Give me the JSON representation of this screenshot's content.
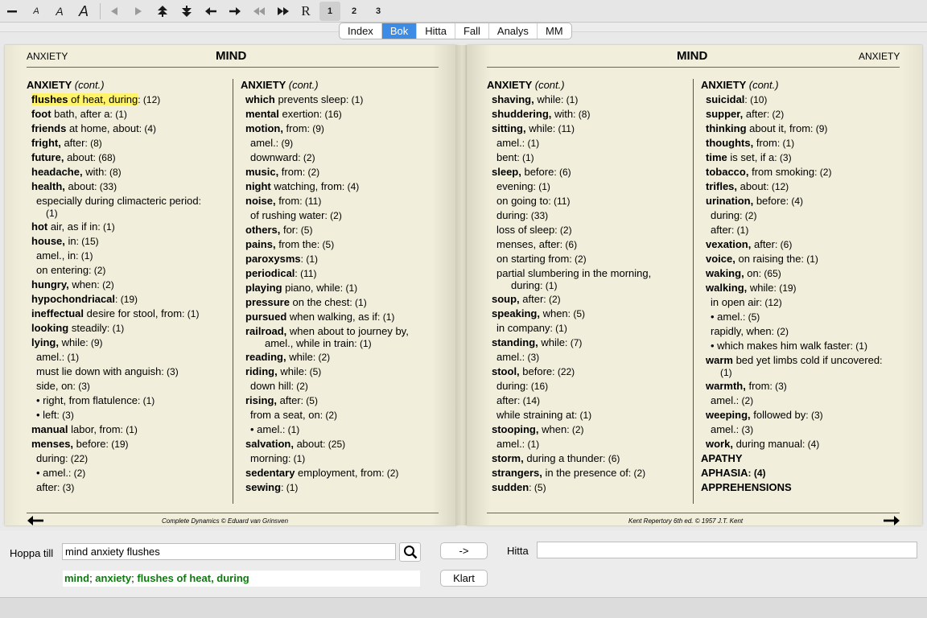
{
  "toolbar": {
    "font_size_labels": [
      "A",
      "A",
      "A"
    ],
    "reset_label": "R",
    "pages": [
      "1",
      "2",
      "3"
    ]
  },
  "tabs": [
    "Index",
    "Bok",
    "Hitta",
    "Fall",
    "Analys",
    "MM"
  ],
  "active_tab": "Bok",
  "left_page": {
    "header_word": "ANXIETY",
    "header_title": "MIND",
    "footer": "Complete Dynamics © Eduard van Grinsven",
    "col1": {
      "head": "ANXIETY",
      "head_cont": "(cont.)",
      "lines": [
        {
          "lvl": 1,
          "b": "flushes",
          "t": " of heat, during",
          "n": ": (12)",
          "hl": true
        },
        {
          "lvl": 1,
          "b": "foot",
          "t": " bath, after a",
          "n": ": (1)"
        },
        {
          "lvl": 1,
          "b": "friends",
          "t": " at home, about",
          "n": ": (4)"
        },
        {
          "lvl": 1,
          "b": "fright,",
          "t": " after",
          "n": ": (8)"
        },
        {
          "lvl": 1,
          "b": "future,",
          "t": " about",
          "n": ": (68)"
        },
        {
          "lvl": 1,
          "b": "headache,",
          "t": " with",
          "n": ": (8)"
        },
        {
          "lvl": 1,
          "b": "health,",
          "t": " about",
          "n": ": (33)"
        },
        {
          "lvl": 2,
          "b": "",
          "t": "especially during climacteric period",
          "n": ":"
        },
        {
          "lvl": 4,
          "b": "",
          "t": "",
          "n": "(1)",
          "cont": true
        },
        {
          "lvl": 1,
          "b": "hot",
          "t": " air, as if in",
          "n": ": (1)"
        },
        {
          "lvl": 1,
          "b": "house,",
          "t": " in",
          "n": ": (15)"
        },
        {
          "lvl": 2,
          "b": "",
          "t": "amel., in",
          "n": ": (1)"
        },
        {
          "lvl": 2,
          "b": "",
          "t": "on entering",
          "n": ": (2)"
        },
        {
          "lvl": 1,
          "b": "hungry,",
          "t": " when",
          "n": ": (2)"
        },
        {
          "lvl": 1,
          "b": "hypochondriacal",
          "t": "",
          "n": ": (19)"
        },
        {
          "lvl": 1,
          "b": "ineffectual",
          "t": " desire for stool, from",
          "n": ": (1)"
        },
        {
          "lvl": 1,
          "b": "looking",
          "t": " steadily",
          "n": ": (1)"
        },
        {
          "lvl": 1,
          "b": "lying,",
          "t": " while",
          "n": ": (9)"
        },
        {
          "lvl": 2,
          "b": "",
          "t": "amel.",
          "n": ": (1)"
        },
        {
          "lvl": 2,
          "b": "",
          "t": "must lie down with anguish",
          "n": ": (3)"
        },
        {
          "lvl": 2,
          "b": "",
          "t": "side, on",
          "n": ": (3)"
        },
        {
          "lvl": 2,
          "b": "",
          "t": "• right, from flatulence",
          "n": ": (1)"
        },
        {
          "lvl": 2,
          "b": "",
          "t": "• left",
          "n": ": (3)"
        },
        {
          "lvl": 1,
          "b": "manual",
          "t": " labor, from",
          "n": ": (1)"
        },
        {
          "lvl": 1,
          "b": "menses,",
          "t": " before",
          "n": ": (19)"
        },
        {
          "lvl": 2,
          "b": "",
          "t": "during",
          "n": ": (22)"
        },
        {
          "lvl": 2,
          "b": "",
          "t": "• amel.",
          "n": ": (2)"
        },
        {
          "lvl": 2,
          "b": "",
          "t": "after",
          "n": ": (3)"
        }
      ]
    },
    "col2": {
      "head": "ANXIETY",
      "head_cont": "(cont.)",
      "lines": [
        {
          "lvl": 1,
          "b": "which",
          "t": " prevents sleep",
          "n": ": (1)"
        },
        {
          "lvl": 1,
          "b": "mental",
          "t": " exertion",
          "n": ": (16)"
        },
        {
          "lvl": 1,
          "b": "motion,",
          "t": " from",
          "n": ": (9)"
        },
        {
          "lvl": 2,
          "b": "",
          "t": "amel.",
          "n": ": (9)"
        },
        {
          "lvl": 2,
          "b": "",
          "t": "downward",
          "n": ": (2)"
        },
        {
          "lvl": 1,
          "b": "music,",
          "t": " from",
          "n": ": (2)"
        },
        {
          "lvl": 1,
          "b": "night",
          "t": " watching, from",
          "n": ": (4)"
        },
        {
          "lvl": 1,
          "b": "noise,",
          "t": " from",
          "n": ": (11)"
        },
        {
          "lvl": 2,
          "b": "",
          "t": "of rushing water",
          "n": ": (2)"
        },
        {
          "lvl": 1,
          "b": "others,",
          "t": " for",
          "n": ": (5)"
        },
        {
          "lvl": 1,
          "b": "pains,",
          "t": " from the",
          "n": ": (5)"
        },
        {
          "lvl": 1,
          "b": "paroxysms",
          "t": "",
          "n": ": (1)"
        },
        {
          "lvl": 1,
          "b": "periodical",
          "t": "",
          "n": ": (11)"
        },
        {
          "lvl": 1,
          "b": "playing",
          "t": " piano, while",
          "n": ": (1)"
        },
        {
          "lvl": 1,
          "b": "pressure",
          "t": " on the chest",
          "n": ": (1)"
        },
        {
          "lvl": 1,
          "b": "pursued",
          "t": " when walking, as if",
          "n": ": (1)"
        },
        {
          "lvl": 1,
          "b": "railroad,",
          "t": " when about to journey by,",
          "n": ""
        },
        {
          "lvl": 3,
          "b": "",
          "t": "amel., while in train",
          "n": ": (1)",
          "cont": true
        },
        {
          "lvl": 1,
          "b": "reading,",
          "t": " while",
          "n": ": (2)"
        },
        {
          "lvl": 1,
          "b": "riding,",
          "t": " while",
          "n": ": (5)"
        },
        {
          "lvl": 2,
          "b": "",
          "t": "down hill",
          "n": ": (2)"
        },
        {
          "lvl": 1,
          "b": "rising,",
          "t": " after",
          "n": ": (5)"
        },
        {
          "lvl": 2,
          "b": "",
          "t": "from a seat, on",
          "n": ": (2)"
        },
        {
          "lvl": 2,
          "b": "",
          "t": "• amel.",
          "n": ": (1)"
        },
        {
          "lvl": 1,
          "b": "salvation,",
          "t": " about",
          "n": ": (25)"
        },
        {
          "lvl": 2,
          "b": "",
          "t": "morning",
          "n": ": (1)"
        },
        {
          "lvl": 1,
          "b": "sedentary",
          "t": " employment, from",
          "n": ": (2)"
        },
        {
          "lvl": 1,
          "b": "sewing",
          "t": "",
          "n": ": (1)"
        }
      ]
    }
  },
  "right_page": {
    "header_word": "ANXIETY",
    "header_title": "MIND",
    "footer": "Kent Repertory 6th ed. © 1957 J.T. Kent",
    "col1": {
      "head": "ANXIETY",
      "head_cont": "(cont.)",
      "lines": [
        {
          "lvl": 1,
          "b": "shaving,",
          "t": " while",
          "n": ": (1)"
        },
        {
          "lvl": 1,
          "b": "shuddering,",
          "t": " with",
          "n": ": (8)"
        },
        {
          "lvl": 1,
          "b": "sitting,",
          "t": " while",
          "n": ": (11)"
        },
        {
          "lvl": 2,
          "b": "",
          "t": "amel.",
          "n": ": (1)"
        },
        {
          "lvl": 2,
          "b": "",
          "t": "bent",
          "n": ": (1)"
        },
        {
          "lvl": 1,
          "b": "sleep,",
          "t": " before",
          "n": ": (6)"
        },
        {
          "lvl": 2,
          "b": "",
          "t": "evening",
          "n": ": (1)"
        },
        {
          "lvl": 2,
          "b": "",
          "t": "on going to",
          "n": ": (11)"
        },
        {
          "lvl": 2,
          "b": "",
          "t": "during",
          "n": ": (33)"
        },
        {
          "lvl": 2,
          "b": "",
          "t": "loss of sleep",
          "n": ": (2)"
        },
        {
          "lvl": 2,
          "b": "",
          "t": "menses, after",
          "n": ": (6)"
        },
        {
          "lvl": 2,
          "b": "",
          "t": "on starting from",
          "n": ": (2)"
        },
        {
          "lvl": 2,
          "b": "",
          "t": "partial slumbering in the morning,",
          "n": ""
        },
        {
          "lvl": 3,
          "b": "",
          "t": "during",
          "n": ": (1)",
          "cont": true
        },
        {
          "lvl": 1,
          "b": "soup,",
          "t": " after",
          "n": ": (2)"
        },
        {
          "lvl": 1,
          "b": "speaking,",
          "t": " when",
          "n": ": (5)"
        },
        {
          "lvl": 2,
          "b": "",
          "t": "in company",
          "n": ": (1)"
        },
        {
          "lvl": 1,
          "b": "standing,",
          "t": " while",
          "n": ": (7)"
        },
        {
          "lvl": 2,
          "b": "",
          "t": "amel.",
          "n": ": (3)"
        },
        {
          "lvl": 1,
          "b": "stool,",
          "t": " before",
          "n": ": (22)"
        },
        {
          "lvl": 2,
          "b": "",
          "t": "during",
          "n": ": (16)"
        },
        {
          "lvl": 2,
          "b": "",
          "t": "after",
          "n": ": (14)"
        },
        {
          "lvl": 2,
          "b": "",
          "t": "while straining at",
          "n": ": (1)"
        },
        {
          "lvl": 1,
          "b": "stooping,",
          "t": " when",
          "n": ": (2)"
        },
        {
          "lvl": 2,
          "b": "",
          "t": "amel.",
          "n": ": (1)"
        },
        {
          "lvl": 1,
          "b": "storm,",
          "t": " during a thunder",
          "n": ": (6)"
        },
        {
          "lvl": 1,
          "b": "strangers,",
          "t": " in the presence of",
          "n": ": (2)"
        },
        {
          "lvl": 1,
          "b": "sudden",
          "t": "",
          "n": ": (5)"
        }
      ]
    },
    "col2": {
      "head": "ANXIETY",
      "head_cont": "(cont.)",
      "lines": [
        {
          "lvl": 1,
          "b": "suicidal",
          "t": "",
          "n": ": (10)"
        },
        {
          "lvl": 1,
          "b": "supper,",
          "t": " after",
          "n": ": (2)"
        },
        {
          "lvl": 1,
          "b": "thinking",
          "t": " about it, from",
          "n": ": (9)"
        },
        {
          "lvl": 1,
          "b": "thoughts,",
          "t": " from",
          "n": ": (1)"
        },
        {
          "lvl": 1,
          "b": "time",
          "t": " is set, if a",
          "n": ": (3)"
        },
        {
          "lvl": 1,
          "b": "tobacco,",
          "t": " from smoking",
          "n": ": (2)"
        },
        {
          "lvl": 1,
          "b": "trifles,",
          "t": " about",
          "n": ": (12)"
        },
        {
          "lvl": 1,
          "b": "urination,",
          "t": " before",
          "n": ": (4)"
        },
        {
          "lvl": 2,
          "b": "",
          "t": "during",
          "n": ": (2)"
        },
        {
          "lvl": 2,
          "b": "",
          "t": "after",
          "n": ": (1)"
        },
        {
          "lvl": 1,
          "b": "vexation,",
          "t": " after",
          "n": ": (6)"
        },
        {
          "lvl": 1,
          "b": "voice,",
          "t": " on raising the",
          "n": ": (1)"
        },
        {
          "lvl": 1,
          "b": "waking,",
          "t": " on",
          "n": ": (65)"
        },
        {
          "lvl": 1,
          "b": "walking,",
          "t": " while",
          "n": ": (19)"
        },
        {
          "lvl": 2,
          "b": "",
          "t": "in open air",
          "n": ": (12)"
        },
        {
          "lvl": 2,
          "b": "",
          "t": "• amel.",
          "n": ": (5)"
        },
        {
          "lvl": 2,
          "b": "",
          "t": "rapidly, when",
          "n": ": (2)"
        },
        {
          "lvl": 2,
          "b": "",
          "t": "• which makes him walk faster",
          "n": ": (1)"
        },
        {
          "lvl": 1,
          "b": "warm",
          "t": " bed yet limbs cold if uncovered",
          "n": ":"
        },
        {
          "lvl": 4,
          "b": "",
          "t": "",
          "n": "(1)",
          "cont": true
        },
        {
          "lvl": 1,
          "b": "warmth,",
          "t": " from",
          "n": ": (3)"
        },
        {
          "lvl": 2,
          "b": "",
          "t": "amel.",
          "n": ": (2)"
        },
        {
          "lvl": 1,
          "b": "weeping,",
          "t": " followed by",
          "n": ": (3)"
        },
        {
          "lvl": 2,
          "b": "",
          "t": "amel.",
          "n": ": (3)"
        },
        {
          "lvl": 1,
          "b": "work,",
          "t": " during manual",
          "n": ": (4)"
        },
        {
          "lvl": 0,
          "b": "APATHY",
          "t": "",
          "n": ""
        },
        {
          "lvl": 0,
          "b": "APHASIA",
          "t": "",
          "n": ": (4)"
        },
        {
          "lvl": 0,
          "b": "APPREHENSIONS",
          "t": "",
          "n": ""
        }
      ]
    }
  },
  "bottom": {
    "jump_label": "Hoppa till",
    "jump_value": "mind anxiety flushes",
    "go_button": "->",
    "find_label": "Hitta",
    "find_value": "",
    "clear_button": "Klart",
    "path": [
      "mind",
      "anxiety",
      "flushes of heat, during"
    ],
    "path_sep": "; "
  }
}
